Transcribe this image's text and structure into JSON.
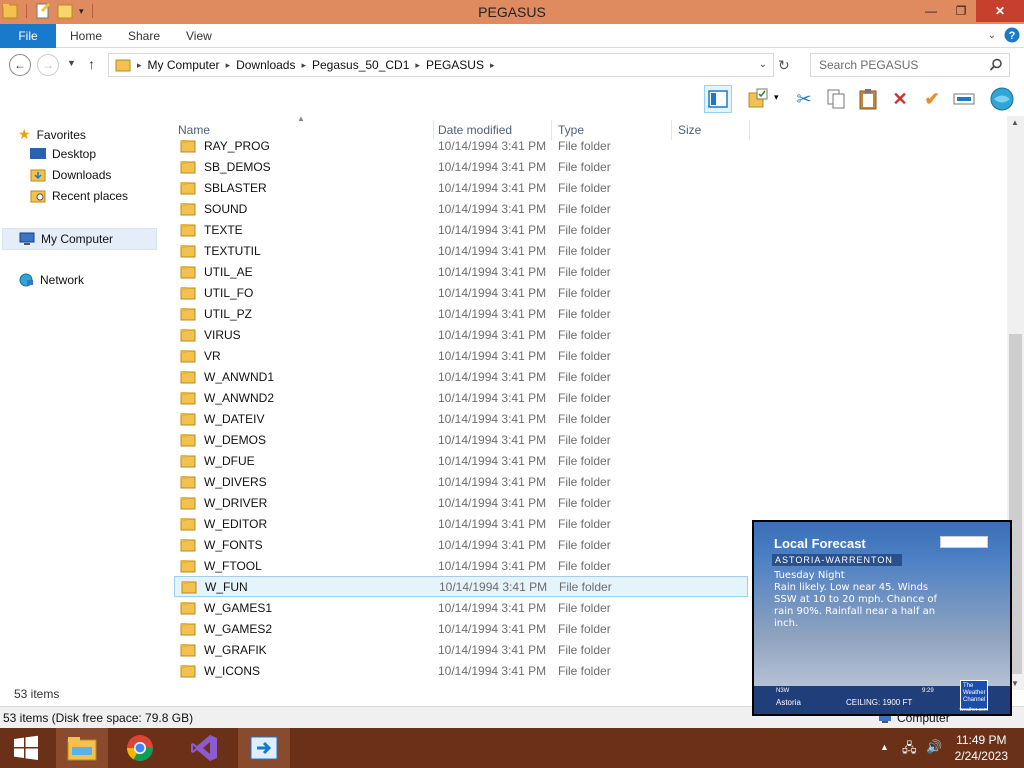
{
  "window": {
    "title": "PEGASUS"
  },
  "ribbon": {
    "tabs": [
      "File",
      "Home",
      "Share",
      "View"
    ]
  },
  "address": {
    "crumbs": [
      "My Computer",
      "Downloads",
      "Pegasus_50_CD1",
      "PEGASUS"
    ],
    "search_placeholder": "Search PEGASUS"
  },
  "nav": {
    "favorites": "Favorites",
    "desktop": "Desktop",
    "downloads": "Downloads",
    "recent": "Recent places",
    "computer": "My Computer",
    "network": "Network"
  },
  "columns": {
    "name": "Name",
    "date": "Date modified",
    "type": "Type",
    "size": "Size"
  },
  "files": [
    {
      "name": "RAY_PROG",
      "date": "10/14/1994 3:41 PM",
      "type": "File folder"
    },
    {
      "name": "SB_DEMOS",
      "date": "10/14/1994 3:41 PM",
      "type": "File folder"
    },
    {
      "name": "SBLASTER",
      "date": "10/14/1994 3:41 PM",
      "type": "File folder"
    },
    {
      "name": "SOUND",
      "date": "10/14/1994 3:41 PM",
      "type": "File folder"
    },
    {
      "name": "TEXTE",
      "date": "10/14/1994 3:41 PM",
      "type": "File folder"
    },
    {
      "name": "TEXTUTIL",
      "date": "10/14/1994 3:41 PM",
      "type": "File folder"
    },
    {
      "name": "UTIL_AE",
      "date": "10/14/1994 3:41 PM",
      "type": "File folder"
    },
    {
      "name": "UTIL_FO",
      "date": "10/14/1994 3:41 PM",
      "type": "File folder"
    },
    {
      "name": "UTIL_PZ",
      "date": "10/14/1994 3:41 PM",
      "type": "File folder"
    },
    {
      "name": "VIRUS",
      "date": "10/14/1994 3:41 PM",
      "type": "File folder"
    },
    {
      "name": "VR",
      "date": "10/14/1994 3:41 PM",
      "type": "File folder"
    },
    {
      "name": "W_ANWND1",
      "date": "10/14/1994 3:41 PM",
      "type": "File folder"
    },
    {
      "name": "W_ANWND2",
      "date": "10/14/1994 3:41 PM",
      "type": "File folder"
    },
    {
      "name": "W_DATEIV",
      "date": "10/14/1994 3:41 PM",
      "type": "File folder"
    },
    {
      "name": "W_DEMOS",
      "date": "10/14/1994 3:41 PM",
      "type": "File folder"
    },
    {
      "name": "W_DFUE",
      "date": "10/14/1994 3:41 PM",
      "type": "File folder"
    },
    {
      "name": "W_DIVERS",
      "date": "10/14/1994 3:41 PM",
      "type": "File folder"
    },
    {
      "name": "W_DRIVER",
      "date": "10/14/1994 3:41 PM",
      "type": "File folder"
    },
    {
      "name": "W_EDITOR",
      "date": "10/14/1994 3:41 PM",
      "type": "File folder"
    },
    {
      "name": "W_FONTS",
      "date": "10/14/1994 3:41 PM",
      "type": "File folder"
    },
    {
      "name": "W_FTOOL",
      "date": "10/14/1994 3:41 PM",
      "type": "File folder"
    },
    {
      "name": "W_FUN",
      "date": "10/14/1994 3:41 PM",
      "type": "File folder"
    },
    {
      "name": "W_GAMES1",
      "date": "10/14/1994 3:41 PM",
      "type": "File folder"
    },
    {
      "name": "W_GAMES2",
      "date": "10/14/1994 3:41 PM",
      "type": "File folder"
    },
    {
      "name": "W_GRAFIK",
      "date": "10/14/1994 3:41 PM",
      "type": "File folder"
    },
    {
      "name": "W_ICONS",
      "date": "10/14/1994 3:41 PM",
      "type": "File folder"
    }
  ],
  "selected_index": 21,
  "status": {
    "items": "53 items",
    "disk": "53 items (Disk free space: 79.8 GB)",
    "computer": "Computer"
  },
  "weather": {
    "title": "Local Forecast",
    "location": "ASTORIA-WARRENTON",
    "period": "Tuesday Night",
    "text": "Rain likely. Low near 45. Winds SSW at 10 to 20 mph. Chance of rain 90%. Rainfall near a half an inch.",
    "bar_city": "Astoria",
    "bar_ceiling": "CEILING: 1900 FT",
    "bar_wind": "N3W",
    "bar_time": "9:29",
    "logo": "The Weather Channel",
    "url": "weather.com"
  },
  "clock": {
    "time": "11:49 PM",
    "date": "2/24/2023"
  },
  "colors": {
    "titlebar": "#e08a5f",
    "accent": "#1979ca",
    "taskbar": "#6b3018"
  }
}
